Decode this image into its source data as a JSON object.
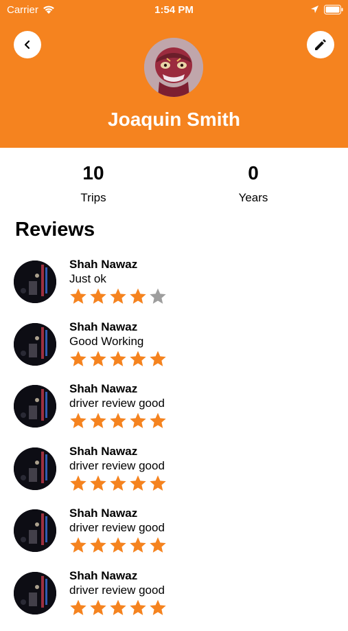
{
  "status_bar": {
    "carrier": "Carrier",
    "time": "1:54 PM"
  },
  "colors": {
    "accent": "#F5831F",
    "star_filled": "#F5831F",
    "star_empty": "#9E9E9E"
  },
  "header": {
    "back_icon": "chevron-left-icon",
    "edit_icon": "pencil-icon",
    "name": "Joaquin Smith"
  },
  "stats": [
    {
      "value": "10",
      "label": "Trips"
    },
    {
      "value": "0",
      "label": "Years"
    }
  ],
  "reviews_title": "Reviews",
  "reviews": [
    {
      "name": "Shah Nawaz",
      "text": "Just ok",
      "rating": 4
    },
    {
      "name": "Shah Nawaz",
      "text": "Good Working",
      "rating": 5
    },
    {
      "name": "Shah Nawaz",
      "text": "driver review good",
      "rating": 5
    },
    {
      "name": "Shah Nawaz",
      "text": "driver review good",
      "rating": 5
    },
    {
      "name": "Shah Nawaz",
      "text": "driver review good",
      "rating": 5
    },
    {
      "name": "Shah Nawaz",
      "text": "driver review good",
      "rating": 5
    }
  ]
}
